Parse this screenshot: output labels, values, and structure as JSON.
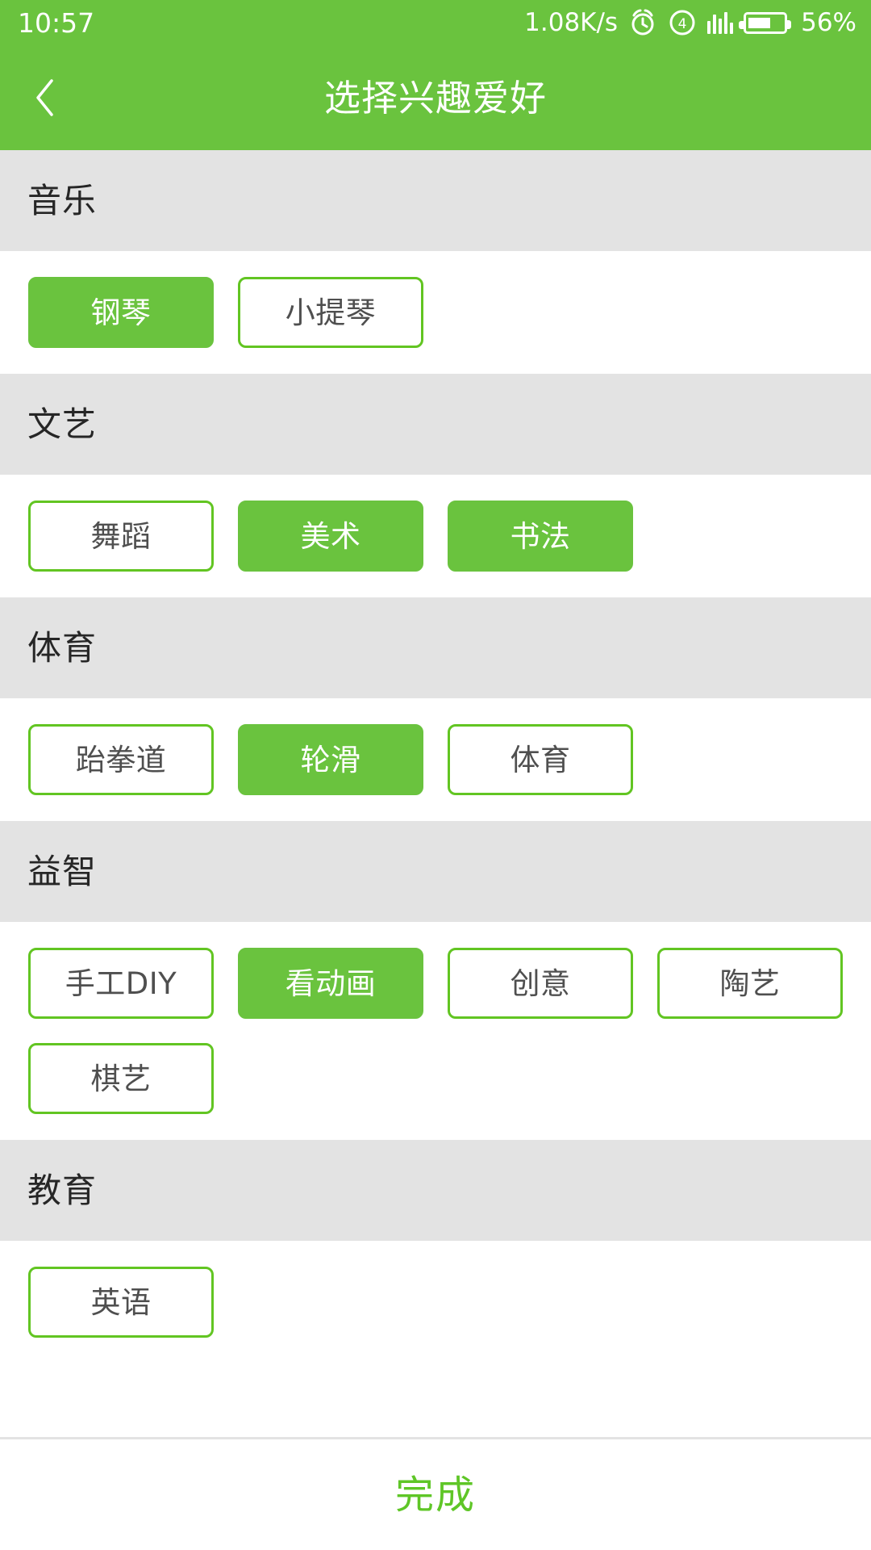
{
  "status_bar": {
    "time": "10:57",
    "network_speed": "1.08K/s",
    "alarm_icon": "alarm-clock-icon",
    "dnd_icon": "do-not-disturb-4-icon",
    "dnd_badge": "4",
    "signal_icon": "signal-bars-icon",
    "battery_icon": "battery-icon",
    "battery_percent": "56%",
    "battery_level": 56
  },
  "nav_bar": {
    "back_icon": "chevron-left-icon",
    "title": "选择兴趣爱好"
  },
  "colors": {
    "brand_green": "#6ac33e",
    "chip_border_green": "#62c522",
    "section_gray": "#e3e3e3",
    "footer_green": "#5fc627",
    "chip_text_gray": "#4f4f4f",
    "section_title_dark": "#262626"
  },
  "sections": [
    {
      "title": "音乐",
      "chips": [
        {
          "label": "钢琴",
          "selected": true
        },
        {
          "label": "小提琴",
          "selected": false
        }
      ]
    },
    {
      "title": "文艺",
      "chips": [
        {
          "label": "舞蹈",
          "selected": false
        },
        {
          "label": "美术",
          "selected": true
        },
        {
          "label": "书法",
          "selected": true
        }
      ]
    },
    {
      "title": "体育",
      "chips": [
        {
          "label": "跆拳道",
          "selected": false
        },
        {
          "label": "轮滑",
          "selected": true
        },
        {
          "label": "体育",
          "selected": false
        }
      ]
    },
    {
      "title": "益智",
      "chips": [
        {
          "label": "手工DIY",
          "selected": false
        },
        {
          "label": "看动画",
          "selected": true
        },
        {
          "label": "创意",
          "selected": false
        },
        {
          "label": "陶艺",
          "selected": false
        },
        {
          "label": "棋艺",
          "selected": false
        }
      ]
    },
    {
      "title": "教育",
      "chips": [
        {
          "label": "英语",
          "selected": false
        }
      ]
    }
  ],
  "footer": {
    "done_label": "完成"
  }
}
